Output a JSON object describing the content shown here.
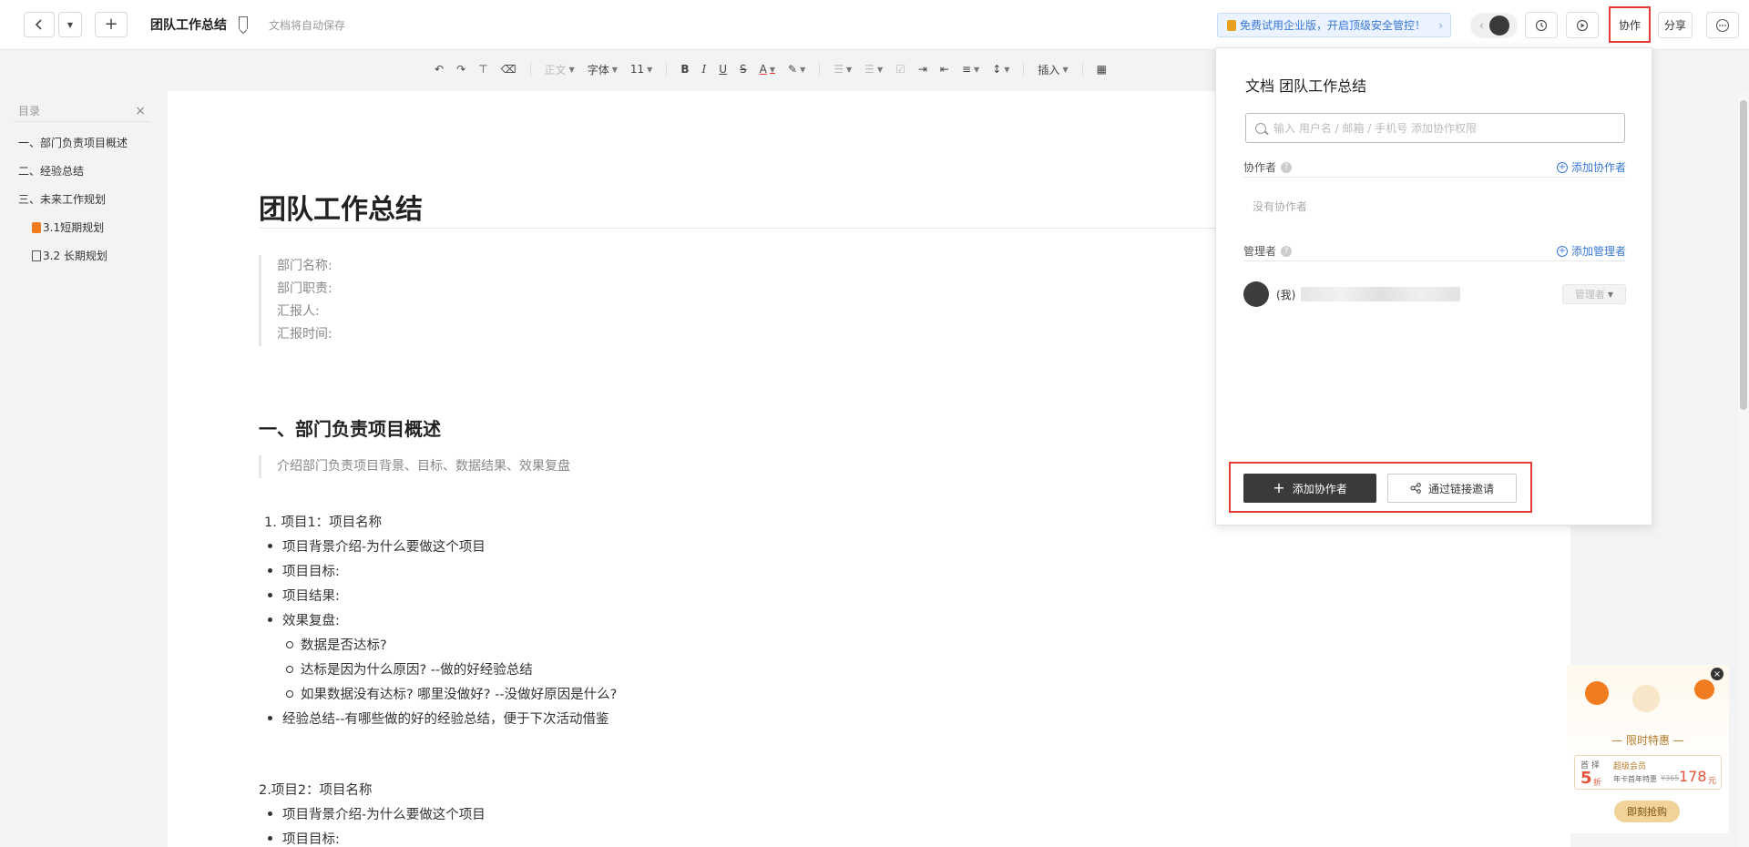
{
  "header": {
    "doc_title": "团队工作总结",
    "autosave": "文档将自动保存",
    "promo": "免费试用企业版，开启顶级安全管控！",
    "collab": "协作",
    "share": "分享"
  },
  "toolbar": {
    "style": "正文",
    "font": "字体",
    "size": "11",
    "insert": "插入"
  },
  "outline": {
    "title": "目录",
    "items": [
      "一、部门负责项目概述",
      "二、经验总结",
      "三、未来工作规划",
      "3.1短期规划",
      "3.2 长期规划"
    ]
  },
  "doc": {
    "title": "团队工作总结",
    "meta": [
      "部门名称:",
      "部门职责:",
      "汇报人:",
      "汇报时间:"
    ],
    "section1": "一、部门负责项目概述",
    "section1_hint": "介绍部门负责项目背景、目标、数据结果、效果复盘",
    "item1": "1. 项目1：项目名称",
    "bullets1": [
      "项目背景介绍-为什么要做这个项目",
      "项目目标:",
      "项目结果:",
      "效果复盘:"
    ],
    "sub_bullets": [
      "数据是否达标?",
      "达标是因为什么原因? --做的好经验总结",
      "如果数据没有达标? 哪里没做好? --没做好原因是什么?"
    ],
    "bullet_last": "经验总结--有哪些做的好的经验总结，便于下次活动借鉴",
    "item2": "2.项目2：项目名称",
    "bullets2": [
      "项目背景介绍-为什么要做这个项目",
      "项目目标:"
    ]
  },
  "panel": {
    "title": "文档 团队工作总结",
    "search_placeholder": "输入 用户名 / 邮箱 / 手机号 添加协作权限",
    "collaborators_label": "协作者",
    "add_collaborator": "添加协作者",
    "no_collaborators": "没有协作者",
    "managers_label": "管理者",
    "add_manager": "添加管理者",
    "me_label": "(我)",
    "role": "管理者",
    "btn_add": "添加协作者",
    "btn_link": "通过链接邀请"
  },
  "ad": {
    "title": "— 限时特惠 —",
    "badge_left": "首 择",
    "discount": "5",
    "discount_unit": "折",
    "member": "超级会员",
    "plan": "年卡首年特惠",
    "old_price": "¥365",
    "price": "178",
    "price_unit": "元",
    "cta": "即刻抢购"
  }
}
